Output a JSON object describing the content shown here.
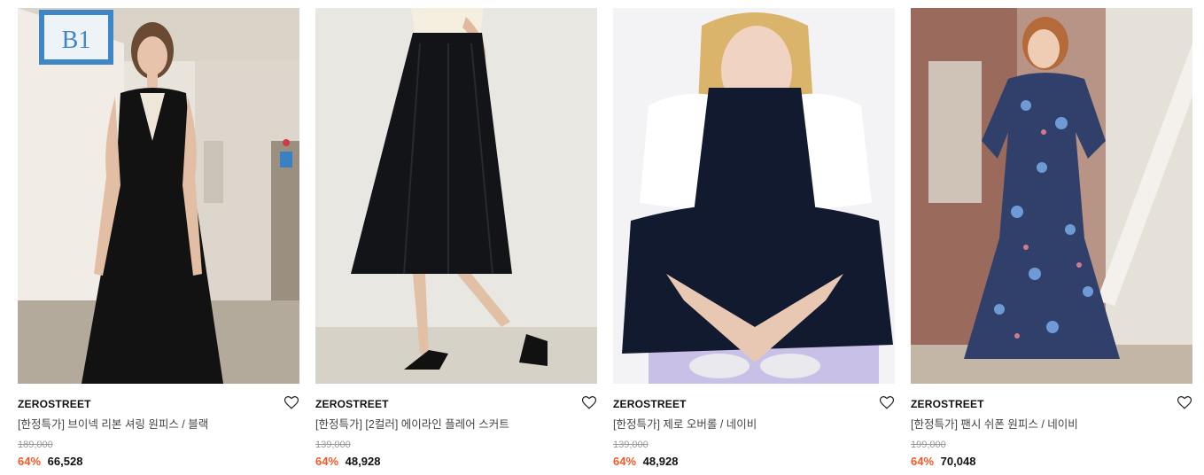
{
  "products": [
    {
      "brand": "ZEROSTREET",
      "name": "[한정특가] 브이넥 리본 셔링 원피스 / 블랙",
      "original_price": "189,000",
      "discount": "64%",
      "sale_price": "66,528",
      "sign_text": "B1"
    },
    {
      "brand": "ZEROSTREET",
      "name": "[한정특가] [2컬러] 에이라인 플레어 스커트",
      "original_price": "139,000",
      "discount": "64%",
      "sale_price": "48,928"
    },
    {
      "brand": "ZEROSTREET",
      "name": "[한정특가] 제로 오버롤 / 네이비",
      "original_price": "139,000",
      "discount": "64%",
      "sale_price": "48,928"
    },
    {
      "brand": "ZEROSTREET",
      "name": "[한정특가] 팬시 쉬폰 원피스 / 네이비",
      "original_price": "199,000",
      "discount": "64%",
      "sale_price": "70,048"
    }
  ],
  "icons": {
    "wishlist": "heart-outline-icon"
  },
  "colors": {
    "discount": "#f05a28",
    "original_price": "#999999",
    "text": "#111111"
  }
}
